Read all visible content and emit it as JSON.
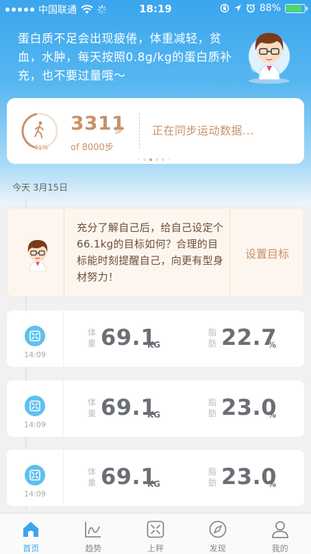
{
  "status_bar": {
    "carrier": "中国联通",
    "time": "18:19",
    "battery": "88%"
  },
  "tip": {
    "text": "蛋白质不足会出现疲倦，体重减轻，贫血，水肿，每天按照0.8g/kg的蛋白质补充，也不要过量哦～"
  },
  "steps": {
    "percent": "41%",
    "count": "3311",
    "unit": "步",
    "goal": "of 8000步",
    "sync_status": "正在同步运动数据...",
    "pager_active": 1
  },
  "date_label": "今天  3月15日",
  "goal_card": {
    "text": "充分了解自己后，给自己设定个66.1kg的目标如何？合理的目标能时刻提醒自己，向更有型身材努力！",
    "button": "设置目标"
  },
  "records": [
    {
      "time": "14:09",
      "weight_label": "体重",
      "weight": "69.1",
      "weight_unit": "KG",
      "fat_label": "脂肪",
      "fat": "22.7",
      "fat_unit": "%"
    },
    {
      "time": "14:09",
      "weight_label": "体重",
      "weight": "69.1",
      "weight_unit": "KG",
      "fat_label": "脂肪",
      "fat": "23.0",
      "fat_unit": "%"
    },
    {
      "time": "14:09",
      "weight_label": "体重",
      "weight": "69.1",
      "weight_unit": "KG",
      "fat_label": "脂肪",
      "fat": "23.0",
      "fat_unit": "%"
    }
  ],
  "tabs": [
    {
      "label": "首页",
      "icon": "home-icon",
      "active": true
    },
    {
      "label": "趋势",
      "icon": "trend-icon",
      "active": false
    },
    {
      "label": "上秤",
      "icon": "scale-icon",
      "active": false
    },
    {
      "label": "发现",
      "icon": "compass-icon",
      "active": false
    },
    {
      "label": "我的",
      "icon": "profile-icon",
      "active": false
    }
  ],
  "colors": {
    "primary_blue": "#3aa6ee",
    "accent_brown": "#c8916a",
    "battery_green": "#4cd964"
  }
}
